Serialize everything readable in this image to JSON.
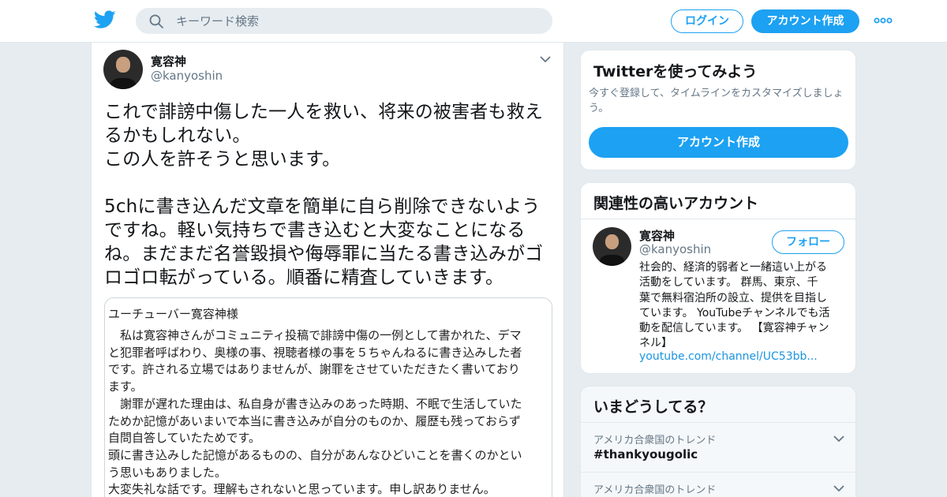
{
  "header": {
    "logo": "twitter-bird-icon",
    "search_placeholder": "キーワード検索",
    "login_label": "ログイン",
    "signup_label": "アカウント作成"
  },
  "tweet": {
    "author_name": "寛容神",
    "author_handle": "@kanyoshin",
    "text": "これで誹謗中傷した一人を救い、将来の被害者も救え\nるかもしれない。\nこの人を許そうと思います。\n\n5chに書き込んだ文章を簡単に自ら削除できないよう\nですね。軽い気持ちで書き込むと大変なことになる\nね。まだまだ名誉毀損や侮辱罪に当たる書き込みがゴ\nロゴロ転がっている。順番に精査していきます。",
    "attachment": {
      "title": "ユーチューバー寛容神様",
      "body": "　私は寛容神さんがコミュニティ投稿で誹謗中傷の一例として書かれた、デマ\nと犯罪者呼ばわり、奥様の事、視聴者様の事を５ちゃんねるに書き込みした者\nです。許される立場ではありませんが、謝罪をさせていただきたく書いており\nます。\n　謝罪が遅れた理由は、私自身が書き込みのあった時期、不眠で生活していた\nためか記憶があいまいで本当に書き込みが自分のものか、履歴も残っておらず\n自問自答していたためです。\n頭に書き込みした記憶があるものの、自分があんなひどいことを書くのかとい\nう思いもありました。\n大変失礼な話です。理解もされないと思っています。申し訳ありません。"
    }
  },
  "sidebar": {
    "try_card": {
      "title": "Twitterを使ってみよう",
      "subtitle": "今すぐ登録して、タイムラインをカスタマイズしましょう。",
      "button": "アカウント作成"
    },
    "related": {
      "title": "関連性の高いアカウント",
      "name": "寛容神",
      "handle": "@kanyoshin",
      "follow": "フォロー",
      "bio": "社会的、経済的弱者と一緒這い上がる\n活動をしています。 群馬、東京、千\n葉で無料宿泊所の設立、提供を目指し\nています。 YouTubeチャンネルでも活\n動を配信しています。 【寛容神チャン\nネル】",
      "link": "youtube.com/channel/UC53bb..."
    },
    "trends": {
      "title": "いまどうしてる？",
      "items": [
        {
          "meta": "アメリカ合衆国のトレンド",
          "name": "#thankyougolic"
        },
        {
          "meta": "アメリカ合衆国のトレンド",
          "name": ""
        }
      ]
    }
  },
  "colors": {
    "accent": "#1da1f2",
    "background": "#e6ecf0"
  }
}
